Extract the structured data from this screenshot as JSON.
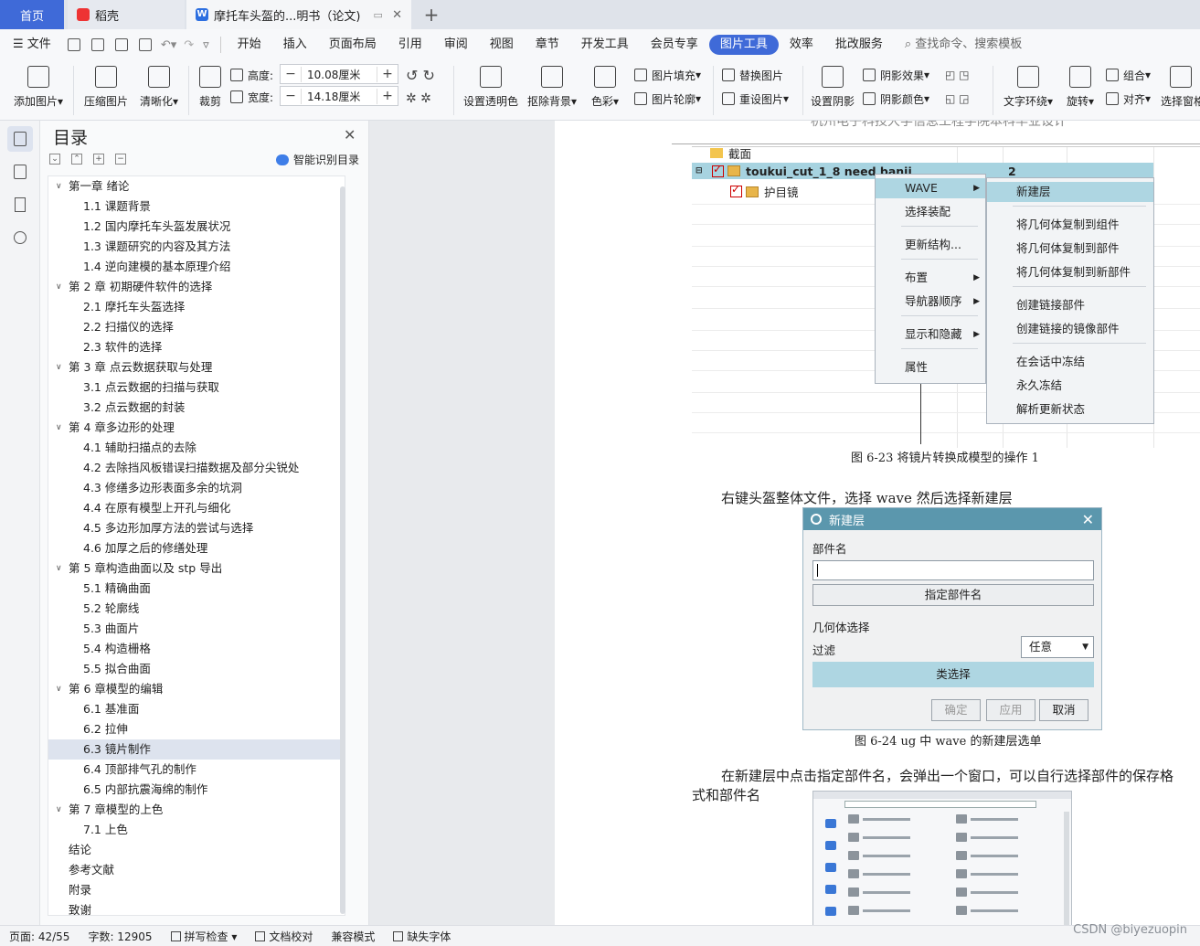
{
  "tabs": {
    "home": "首页",
    "daoke": "稻壳",
    "doc": "摩托车头盔的...明书（论文)",
    "add": "+"
  },
  "menubar": {
    "file": "文件",
    "items": [
      "开始",
      "插入",
      "页面布局",
      "引用",
      "审阅",
      "视图",
      "章节",
      "开发工具",
      "会员专享",
      "图片工具",
      "效率",
      "批改服务"
    ],
    "active": "图片工具",
    "search": "查找命令、搜索模板"
  },
  "ribbon": {
    "add_image": "添加图片",
    "compress": "压缩图片",
    "clarify": "清晰化",
    "crop": "裁剪",
    "height_label": "高度:",
    "height_value": "10.08厘米",
    "width_label": "宽度:",
    "width_value": "14.18厘米",
    "transparent": "设置透明色",
    "remove_bg": "抠除背景",
    "color": "色彩",
    "fill": "图片填充",
    "outline": "图片轮廓",
    "replace": "替换图片",
    "reset": "重设图片",
    "shadow": "设置阴影",
    "shadow_effect": "阴影效果",
    "shadow_color": "阴影颜色",
    "wrap": "文字环绕",
    "rotate": "旋转",
    "group": "组合",
    "align": "对齐",
    "select_pane": "选择窗格"
  },
  "toc": {
    "title": "目录",
    "smart": "智能识别目录",
    "items": [
      {
        "label": "第一章  绪论",
        "level": "ch"
      },
      {
        "label": "1.1 课题背景",
        "level": "sec"
      },
      {
        "label": "1.2 国内摩托车头盔发展状况",
        "level": "sec"
      },
      {
        "label": "1.3 课题研究的内容及其方法",
        "level": "sec"
      },
      {
        "label": "1.4 逆向建模的基本原理介绍",
        "level": "sec"
      },
      {
        "label": "第 2 章  初期硬件软件的选择",
        "level": "ch"
      },
      {
        "label": "2.1 摩托车头盔选择",
        "level": "sec"
      },
      {
        "label": "2.2 扫描仪的选择",
        "level": "sec"
      },
      {
        "label": "2.3  软件的选择",
        "level": "sec"
      },
      {
        "label": "第 3 章    点云数据获取与处理",
        "level": "ch"
      },
      {
        "label": "3.1  点云数据的扫描与获取",
        "level": "sec"
      },
      {
        "label": "3.2  点云数据的封装",
        "level": "sec"
      },
      {
        "label": "第 4 章多边形的处理",
        "level": "ch"
      },
      {
        "label": "4.1  辅助扫描点的去除",
        "level": "sec"
      },
      {
        "label": "4.2  去除挡风板错误扫描数据及部分尖锐处",
        "level": "sec"
      },
      {
        "label": "4.3  修缮多边形表面多余的坑洞",
        "level": "sec"
      },
      {
        "label": "4.4  在原有模型上开孔与细化",
        "level": "sec"
      },
      {
        "label": "4.5  多边形加厚方法的尝试与选择",
        "level": "sec"
      },
      {
        "label": "4.6  加厚之后的修缮处理",
        "level": "sec"
      },
      {
        "label": "第 5 章构造曲面以及 stp 导出",
        "level": "ch"
      },
      {
        "label": "5.1  精确曲面",
        "level": "sec"
      },
      {
        "label": "5.2  轮廓线",
        "level": "sec"
      },
      {
        "label": "5.3  曲面片",
        "level": "sec"
      },
      {
        "label": "5.4  构造栅格",
        "level": "sec"
      },
      {
        "label": "5.5  拟合曲面",
        "level": "sec"
      },
      {
        "label": "第 6 章模型的编辑",
        "level": "ch"
      },
      {
        "label": "6.1  基准面",
        "level": "sec"
      },
      {
        "label": "6.2  拉伸",
        "level": "sec"
      },
      {
        "label": "6.3  镜片制作",
        "level": "sec",
        "selected": true
      },
      {
        "label": "6.4  顶部排气孔的制作",
        "level": "sec"
      },
      {
        "label": "6.5  内部抗震海绵的制作",
        "level": "sec"
      },
      {
        "label": "第 7 章模型的上色",
        "level": "ch"
      },
      {
        "label": "7.1  上色",
        "level": "sec"
      },
      {
        "label": "结论",
        "level": "plain"
      },
      {
        "label": "参考文献",
        "level": "plain"
      },
      {
        "label": "附录",
        "level": "plain"
      },
      {
        "label": "致谢",
        "level": "plain"
      }
    ]
  },
  "document": {
    "header_text": "杭州电子科技大学信息工程学院本科毕业设计",
    "fig1": {
      "tree_root": "截面",
      "tree_file": "toukui_cut_1_8 need banji",
      "tree_file_count": "2",
      "tree_child": "护目镜",
      "menu_main": [
        "WAVE",
        "选择装配",
        "更新结构...",
        "布置",
        "导航器顺序",
        "显示和隐藏",
        "属性"
      ],
      "menu_sub": [
        "新建层",
        "将几何体复制到组件",
        "将几何体复制到部件",
        "将几何体复制到新部件",
        "创建链接部件",
        "创建链接的镜像部件",
        "在会话中冻结",
        "永久冻结",
        "解析更新状态"
      ]
    },
    "caption1": "图 6-23 将镜片转换成模型的操作 1",
    "para1": "右键头盔整体文件，选择 wave 然后选择新建层",
    "dialog": {
      "title": "新建层",
      "part_name_label": "部件名",
      "specify_btn": "指定部件名",
      "geometry_label": "几何体选择",
      "filter_label": "过滤",
      "filter_value": "任意",
      "select_btn": "类选择",
      "ok": "确定",
      "apply": "应用",
      "cancel": "取消"
    },
    "caption2": "图 6-24   ug 中 wave 的新建层选单",
    "para2_line1": "在新建层中点击指定部件名，会弹出一个窗口，可以自行选择部件的保存格",
    "para2_line2": "式和部件名"
  },
  "statusbar": {
    "page": "页面: 42/55",
    "words": "字数: 12905",
    "spell": "拼写检查",
    "proof": "文档校对",
    "compat": "兼容模式",
    "missing_font": "缺失字体"
  },
  "watermark": "CSDN @biyezuopin"
}
